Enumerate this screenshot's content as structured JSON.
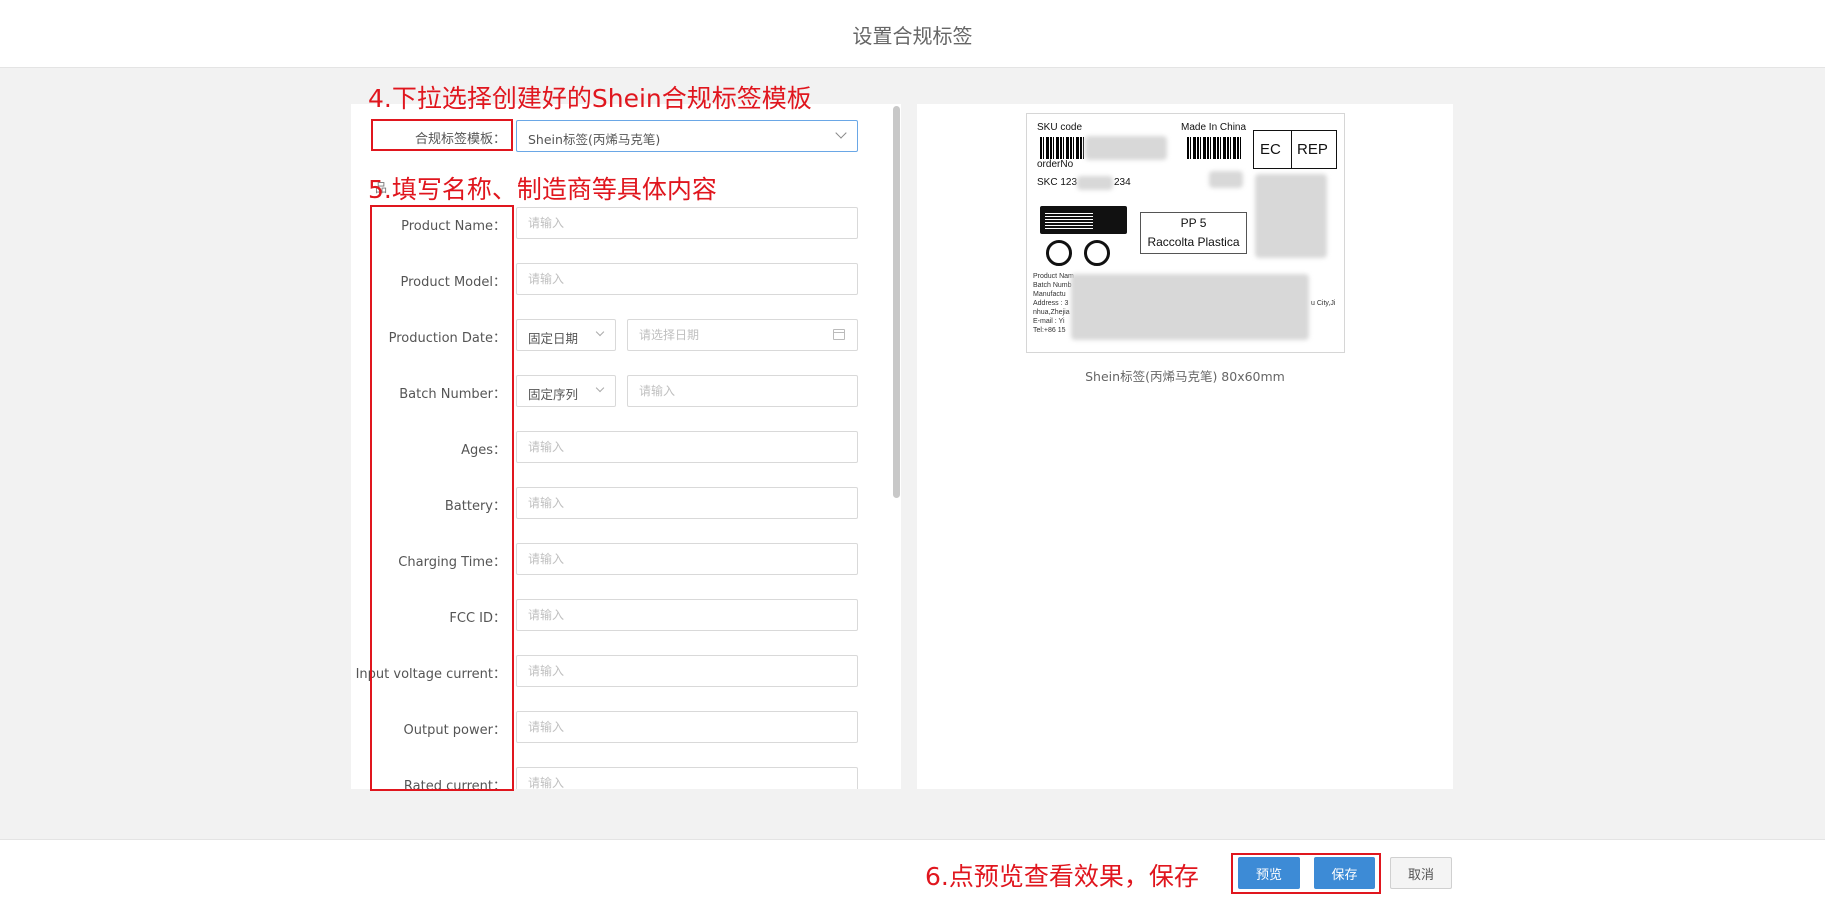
{
  "header": {
    "title": "设置合规标签"
  },
  "form": {
    "template_label": "合规标签模板：",
    "template_value": "Shein标签(丙烯马克笔)",
    "ghost_text": "品",
    "date_mode": "固定日期",
    "date_placeholder": "请选择日期",
    "batch_mode": "固定序列",
    "input_placeholder": "请输入",
    "fields": [
      {
        "label": "Product Name："
      },
      {
        "label": "Product Model："
      },
      {
        "label": "Production Date："
      },
      {
        "label": "Batch Number："
      },
      {
        "label": "Ages："
      },
      {
        "label": "Battery："
      },
      {
        "label": "Charging Time："
      },
      {
        "label": "FCC ID："
      },
      {
        "label": "Input voltage current："
      },
      {
        "label": "Output power："
      },
      {
        "label": "Rated current："
      }
    ]
  },
  "preview": {
    "sku_code": "SKU code",
    "made_in": "Made In China",
    "order_no": "orderNo",
    "skc_prefix": "SKC 123",
    "skc_suffix": "234",
    "ec": "EC",
    "rep": "REP",
    "pp_line1": "PP 5",
    "pp_line2": "Raccolta Plastica",
    "small_lines": [
      "Product Nam",
      "Batch Numb",
      "Manufactu",
      "Address : 3",
      "nhua,Zhejia",
      "E-mail : Yi",
      "Tel:+86 15"
    ],
    "right_text": "u City,Ji",
    "caption": "Shein标签(丙烯马克笔) 80x60mm"
  },
  "annotations": {
    "step4": "4.下拉选择创建好的Shein合规标签模板",
    "step5": "5.填写名称、制造商等具体内容",
    "step6": "6.点预览查看效果，保存"
  },
  "footer": {
    "preview_button": "预览",
    "save_button": "保存",
    "cancel_button": "取消"
  }
}
